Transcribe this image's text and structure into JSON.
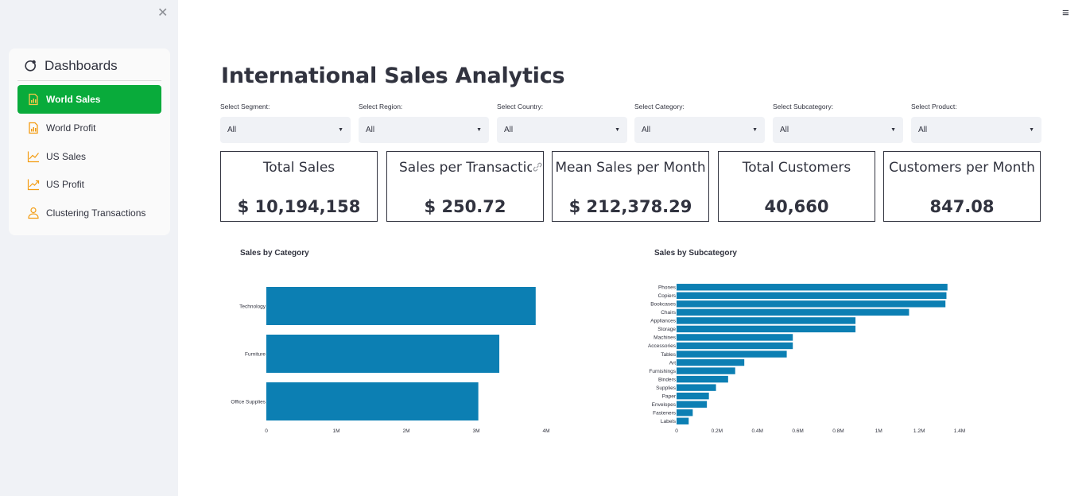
{
  "sidebar": {
    "menu_title": "Dashboards",
    "items": [
      {
        "label": "World Sales",
        "icon": "bar-chart-file-icon",
        "active": true
      },
      {
        "label": "World Profit",
        "icon": "bar-chart-file-icon",
        "active": false
      },
      {
        "label": "US Sales",
        "icon": "line-chart-icon",
        "active": false
      },
      {
        "label": "US Profit",
        "icon": "trend-up-icon",
        "active": false
      },
      {
        "label": "Clustering Transactions",
        "icon": "person-icon",
        "active": false
      }
    ],
    "accent": "#09ab3b",
    "icon_color": "#f39c12"
  },
  "header": {
    "title": "International Sales Analytics"
  },
  "filters": [
    {
      "label": "Select Segment:",
      "value": "All"
    },
    {
      "label": "Select Region:",
      "value": "All"
    },
    {
      "label": "Select Country:",
      "value": "All"
    },
    {
      "label": "Select Category:",
      "value": "All"
    },
    {
      "label": "Select Subcategory:",
      "value": "All"
    },
    {
      "label": "Select Product:",
      "value": "All"
    }
  ],
  "metrics": [
    {
      "label": "Total Sales",
      "value": "$ 10,194,158"
    },
    {
      "label": "Sales per Transaction",
      "value": "$ 250.72"
    },
    {
      "label": "Mean Sales per Month",
      "value": "$ 212,378.29"
    },
    {
      "label": "Total Customers",
      "value": "40,660"
    },
    {
      "label": "Customers per Month",
      "value": "847.08"
    }
  ],
  "chart_data": [
    {
      "type": "bar",
      "orientation": "horizontal",
      "title": "Sales by Category",
      "categories": [
        "Technology",
        "Furniture",
        "Office Supplies"
      ],
      "values": [
        3850000,
        3330000,
        3030000
      ],
      "xlim": [
        0,
        4000000
      ],
      "xticks": [
        "0",
        "1M",
        "2M",
        "3M",
        "4M"
      ],
      "color": "#0c7fb3"
    },
    {
      "type": "bar",
      "orientation": "horizontal",
      "title": "Sales by Subcategory",
      "categories": [
        "Phones",
        "Copiers",
        "Bookcases",
        "Chairs",
        "Appliances",
        "Storage",
        "Machines",
        "Accessories",
        "Tables",
        "Art",
        "Furnishings",
        "Binders",
        "Supplies",
        "Paper",
        "Envelopes",
        "Fasteners",
        "Labels"
      ],
      "values": [
        1340000,
        1335000,
        1330000,
        1150000,
        885000,
        885000,
        575000,
        575000,
        545000,
        335000,
        290000,
        255000,
        195000,
        160000,
        150000,
        80000,
        60000
      ],
      "xlim": [
        0,
        1400000
      ],
      "xticks": [
        "0",
        "0.2M",
        "0.4M",
        "0.6M",
        "0.8M",
        "1M",
        "1.2M",
        "1.4M"
      ],
      "color": "#0c7fb3"
    }
  ]
}
